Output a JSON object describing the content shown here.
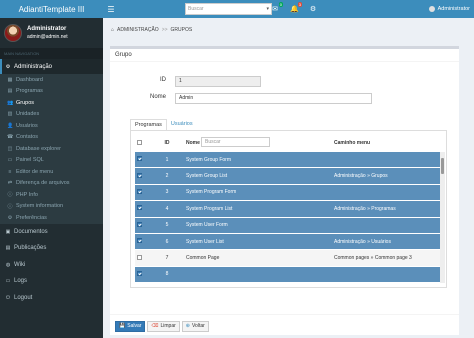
{
  "header": {
    "app_title": "AdiantiTemplate III",
    "menu_toggle_icon": "hamburger-icon",
    "search_placeholder": "Buscar",
    "messages_badge": "0",
    "notifications_badge": "3",
    "user_name": "Administrator"
  },
  "sidebar": {
    "user_name": "Administrator",
    "user_email": "admin@admin.net",
    "nav_header": "MAIN NAVIGATION",
    "items": [
      {
        "label": "Administração",
        "icon": "gear-icon",
        "level": "main"
      },
      {
        "label": "Dashboard",
        "icon": "dashboard-icon",
        "level": "sub"
      },
      {
        "label": "Programas",
        "icon": "file-icon",
        "level": "sub"
      },
      {
        "label": "Grupos",
        "icon": "users-icon",
        "level": "sub",
        "active": true
      },
      {
        "label": "Unidades",
        "icon": "building-icon",
        "level": "sub"
      },
      {
        "label": "Usuários",
        "icon": "user-icon",
        "level": "sub"
      },
      {
        "label": "Contatos",
        "icon": "contacts-icon",
        "level": "sub"
      },
      {
        "label": "Database explorer",
        "icon": "database-icon",
        "level": "sub"
      },
      {
        "label": "Painel SQL",
        "icon": "terminal-icon",
        "level": "sub"
      },
      {
        "label": "Editor de menu",
        "icon": "menu-icon",
        "level": "sub"
      },
      {
        "label": "Diferença de arquivos",
        "icon": "diff-icon",
        "level": "sub"
      },
      {
        "label": "PHP Info",
        "icon": "info-icon",
        "level": "sub"
      },
      {
        "label": "System information",
        "icon": "info-circle-icon",
        "level": "sub"
      },
      {
        "label": "Preferências",
        "icon": "gear-icon",
        "level": "sub"
      },
      {
        "label": "Documentos",
        "icon": "folder-icon",
        "level": "top"
      },
      {
        "label": "Publicações",
        "icon": "newspaper-icon",
        "level": "top"
      },
      {
        "label": "Wiki",
        "icon": "globe-icon",
        "level": "top"
      },
      {
        "label": "Logs",
        "icon": "monitor-icon",
        "level": "top"
      },
      {
        "label": "Logout",
        "icon": "logout-icon",
        "level": "top"
      }
    ]
  },
  "breadcrumb": {
    "home_icon": "home-icon",
    "parts": [
      "ADMINISTRAÇÃO",
      "GRUPOS"
    ],
    "separator": ">>"
  },
  "form": {
    "title": "Grupo",
    "id_label": "ID",
    "id_value": "1",
    "name_label": "Nome",
    "name_value": "Admin",
    "tabs": [
      "Programas",
      "Usuários"
    ],
    "active_tab": "Programas"
  },
  "grid": {
    "columns": {
      "id": "ID",
      "name": "Nome",
      "path": "Caminho menu"
    },
    "name_filter_placeholder": "Buscar",
    "rows": [
      {
        "checked": true,
        "id": "1",
        "name": "System Group Form",
        "path": ""
      },
      {
        "checked": true,
        "id": "2",
        "name": "System Group List",
        "path": "Administração » Grupos"
      },
      {
        "checked": true,
        "id": "3",
        "name": "System Program Form",
        "path": ""
      },
      {
        "checked": true,
        "id": "4",
        "name": "System Program List",
        "path": "Administração » Programas"
      },
      {
        "checked": true,
        "id": "5",
        "name": "System User Form",
        "path": ""
      },
      {
        "checked": true,
        "id": "6",
        "name": "System User List",
        "path": "Administração » Usuários"
      },
      {
        "checked": false,
        "id": "7",
        "name": "Common Page",
        "path": "Common pages » Common page 3"
      },
      {
        "checked": true,
        "id": "8",
        "name": "",
        "path": ""
      }
    ]
  },
  "actions": {
    "save": "Salvar",
    "clear": "Limpar",
    "back": "Voltar"
  },
  "colors": {
    "primary": "#3c8dbc",
    "sidebar_bg": "#222d32",
    "row_selected": "#5b8fba"
  }
}
